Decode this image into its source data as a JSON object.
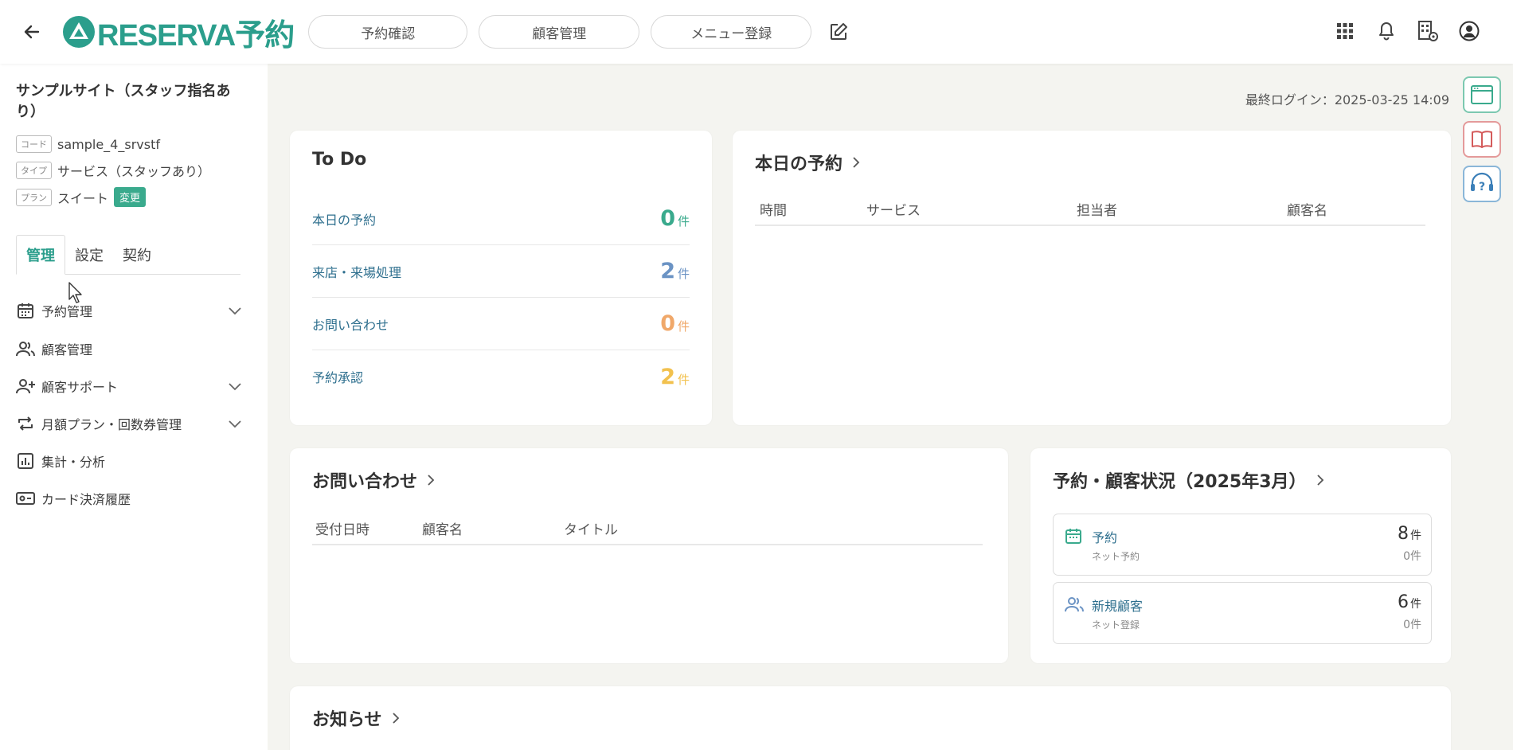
{
  "header": {
    "logo_text": "RESERVA予約",
    "nav": [
      "予約確認",
      "顧客管理",
      "メニュー登録"
    ]
  },
  "sidebar": {
    "site_name": "サンプルサイト（スタッフ指名あり）",
    "code_tag": "コード",
    "code_value": "sample_4_srvstf",
    "type_tag": "タイプ",
    "type_value": "サービス（スタッフあり）",
    "plan_tag": "プラン",
    "plan_value": "スイート",
    "change_label": "変更",
    "tabs": [
      "管理",
      "設定",
      "契約"
    ],
    "menu": [
      {
        "label": "予約管理"
      },
      {
        "label": "顧客管理"
      },
      {
        "label": "顧客サポート"
      },
      {
        "label": "月額プラン・回数券管理"
      },
      {
        "label": "集計・分析"
      },
      {
        "label": "カード決済履歴"
      }
    ]
  },
  "main": {
    "last_login": "最終ログイン：2025-03-25 14:09",
    "todo": {
      "title": "To Do",
      "rows": [
        {
          "label": "本日の予約",
          "count": "0",
          "unit": "件",
          "color": "#3aaa8d"
        },
        {
          "label": "来店・来場処理",
          "count": "2",
          "unit": "件",
          "color": "#6b93c4"
        },
        {
          "label": "お問い合わせ",
          "count": "0",
          "unit": "件",
          "color": "#f0a86a"
        },
        {
          "label": "予約承認",
          "count": "2",
          "unit": "件",
          "color": "#f2c14e"
        }
      ]
    },
    "today": {
      "title": "本日の予約",
      "columns": [
        "時間",
        "サービス",
        "担当者",
        "顧客名"
      ]
    },
    "inquiry": {
      "title": "お問い合わせ",
      "columns": [
        "受付日時",
        "顧客名",
        "タイトル"
      ]
    },
    "status": {
      "title": "予約・顧客状況（2025年3月）",
      "boxes": [
        {
          "label": "予約",
          "sub": "ネット予約",
          "count": "8",
          "unit": "件",
          "sub_count": "0件"
        },
        {
          "label": "新規顧客",
          "sub": "ネット登録",
          "count": "6",
          "unit": "件",
          "sub_count": "0件"
        }
      ]
    },
    "news": {
      "title": "お知らせ"
    }
  },
  "colors": {
    "brand": "#2b9e8c",
    "link": "#2e6f8e"
  }
}
